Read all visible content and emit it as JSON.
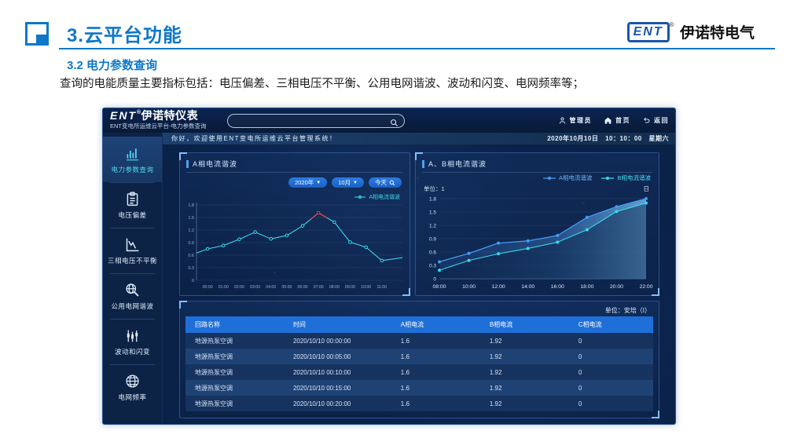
{
  "colors": {
    "accent_blue": "#0d78c8",
    "dash_bg": "#0a2148",
    "cyan_line": "#3fd6ec",
    "series_a_blue": "#4699f2",
    "series_b_cyan": "#38d8ee",
    "highlight_red": "#e04a3c",
    "pill_blue": "#1f6fd8",
    "table_header_blue": "#1f6fd8"
  },
  "slide": {
    "title": "3.云平台功能",
    "subtitle": "3.2 电力参数查询",
    "body_text": "查询的电能质量主要指标包括：电压偏差、三相电压不平衡、公用电网谐波、波动和闪变、电网频率等；",
    "brand": {
      "logo_text": "ENT",
      "reg_mark": "®",
      "company": "伊诺特电气"
    }
  },
  "app": {
    "logo": {
      "text": "ENT",
      "reg": "®",
      "name": "伊诺特仪表",
      "subtitle": "ENT变电所运维云平台-电力参数查询"
    },
    "search": {
      "placeholder": ""
    },
    "user_menu": [
      {
        "icon": "user-icon",
        "label": "管理员"
      },
      {
        "icon": "home-icon",
        "label": "首页"
      },
      {
        "icon": "back-icon",
        "label": "返回"
      }
    ],
    "welcome": "你好，欢迎使用ENT变电所运维云平台管理系统！",
    "datetime": {
      "date": "2020年10月10日",
      "time": "10：10：00",
      "weekday": "星期六"
    },
    "sidebar": [
      {
        "icon": "bar-chart-icon",
        "label": "电力参数查询",
        "active": true
      },
      {
        "icon": "clipboard-icon",
        "label": "电压偏差",
        "active": false
      },
      {
        "icon": "line-chart-icon",
        "label": "三相电压不平衡",
        "active": false
      },
      {
        "icon": "globe-search-icon",
        "label": "公用电网谐波",
        "active": false
      },
      {
        "icon": "flicker-bars-icon",
        "label": "波动和闪变",
        "active": false
      },
      {
        "icon": "globe-icon",
        "label": "电网频率",
        "active": false
      }
    ],
    "filters": {
      "year": "2020年",
      "month": "10月",
      "today": "今天"
    },
    "table": {
      "unit": "单位：安培（I）",
      "headers": [
        "回路名称",
        "时间",
        "A相电流",
        "B相电流",
        "C相电流"
      ],
      "rows": [
        [
          "地源热泵空调",
          "2020/10/10 00:00:00",
          "1.6",
          "1.92",
          "0"
        ],
        [
          "地源热泵空调",
          "2020/10/10 00:05:00",
          "1.6",
          "1.92",
          "0"
        ],
        [
          "地源热泵空调",
          "2020/10/10 00:10:00",
          "1.6",
          "1.92",
          "0"
        ],
        [
          "地源热泵空调",
          "2020/10/10 00:15:00",
          "1.6",
          "1.92",
          "0"
        ],
        [
          "地源热泵空调",
          "2020/10/10 00:20:00",
          "1.6",
          "1.92",
          "0"
        ]
      ]
    }
  },
  "chart_data": [
    {
      "type": "line",
      "title": "A相电流谐波",
      "x": [
        "00:00",
        "01:00",
        "02:00",
        "03:00",
        "04:00",
        "05:00",
        "06:00",
        "07:00",
        "08:00",
        "09:00",
        "10:00",
        "11:00"
      ],
      "series": [
        {
          "name": "A相电流谐波",
          "color": "#3fd6ec",
          "values": [
            0.75,
            0.83,
            0.98,
            1.15,
            0.99,
            1.07,
            1.3,
            1.61,
            1.39,
            0.91,
            0.79,
            0.47
          ]
        }
      ],
      "edge_start": 0.65,
      "edge_end": 0.54,
      "ylim": [
        0,
        1.8
      ],
      "yticks": [
        "0",
        "0.3",
        "0.6",
        "0.9",
        "1.2",
        "1.5",
        "1.8"
      ],
      "highlight": {
        "color": "#e04a3c",
        "note": "segment around 07:00 peak drawn in red"
      },
      "legend_position": "top-right",
      "grid": true
    },
    {
      "type": "area",
      "title": "A、B相电流谐波",
      "unit_label": "单位：1",
      "period_label": "日",
      "x": [
        "08:00",
        "10:00",
        "12:00",
        "14:00",
        "16:00",
        "18:00",
        "20:00",
        "22:00"
      ],
      "series": [
        {
          "name": "A相电流谐波",
          "color": "#4699f2",
          "values": [
            0.38,
            0.57,
            0.8,
            0.85,
            0.97,
            1.38,
            1.62,
            1.8
          ]
        },
        {
          "name": "B相电流谐波",
          "color": "#38d8ee",
          "values": [
            0.19,
            0.41,
            0.56,
            0.68,
            0.82,
            1.1,
            1.51,
            1.7
          ]
        }
      ],
      "ylim": [
        0,
        1.8
      ],
      "yticks": [
        "0",
        "0.3",
        "0.6",
        "0.9",
        "1.2",
        "1.5",
        "1.8"
      ],
      "legend_position": "top-right",
      "grid": true
    }
  ]
}
